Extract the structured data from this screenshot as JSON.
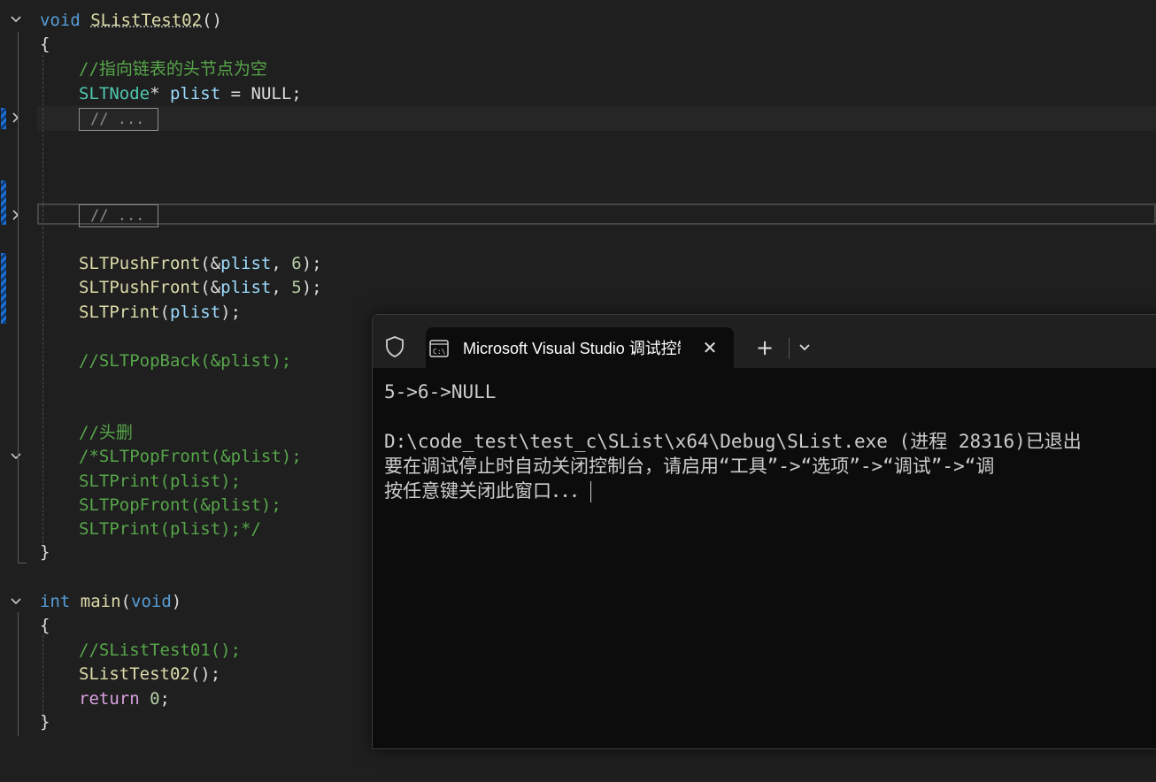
{
  "editor": {
    "lines": {
      "l_void": {
        "kw": "void",
        "fn": "SListTest02",
        "paren": "()"
      },
      "l_open1": "{",
      "l_cm1": "//指向链表的头节点为空",
      "l_decl": {
        "type": "SLTNode",
        "star": "*",
        "var": "plist",
        "rest": " = NULL;"
      },
      "l_collapsed1": "// ...",
      "l_collapsed2": "// ...",
      "l_push1": {
        "fn": "SLTPushFront",
        "pre": "(&",
        "var": "plist",
        "mid": ", ",
        "num": "6",
        "end": ");"
      },
      "l_push2": {
        "fn": "SLTPushFront",
        "pre": "(&",
        "var": "plist",
        "mid": ", ",
        "num": "5",
        "end": ");"
      },
      "l_print": {
        "fn": "SLTPrint",
        "pre": "(",
        "var": "plist",
        "end": ");"
      },
      "l_popback": "//SLTPopBack(&plist);",
      "l_cm_head": "//头删",
      "l_blk1": "/*SLTPopFront(&plist);",
      "l_blk2": "SLTPrint(plist);",
      "l_blk3": "SLTPopFront(&plist);",
      "l_blk4": "SLTPrint(plist);*/",
      "l_close1": "}",
      "l_main": {
        "kw": "int",
        "fn": "main",
        "pre": "(",
        "kw2": "void",
        "end": ")"
      },
      "l_open2": "{",
      "l_cm_test01": "//SListTest01();",
      "l_call02": {
        "fn": "SListTest02",
        "end": "();"
      },
      "l_return": {
        "kw": "return",
        "sp": " ",
        "num": "0",
        "end": ";"
      },
      "l_close2": "}"
    }
  },
  "terminal": {
    "tab_title": "Microsoft Visual Studio 调试控制台",
    "close_glyph": "✕",
    "new_tab_glyph": "+",
    "output": [
      "5->6->NULL",
      "",
      "D:\\code_test\\test_c\\SList\\x64\\Debug\\SList.exe (进程 28316)已退出",
      "要在调试停止时自动关闭控制台，请启用“工具”->“选项”->“调试”->“调",
      "按任意键关闭此窗口．．．"
    ]
  },
  "colors": {
    "editor_bg": "#1f1f1f",
    "keyword": "#569cd6",
    "function": "#dcdcaa",
    "type": "#4ec9b0",
    "variable": "#9cdcfe",
    "comment": "#57a64a",
    "terminal_bg": "#0c0c0c"
  },
  "icons": [
    "chevron-down-icon",
    "chevron-right-icon",
    "shield-icon",
    "console-app-icon",
    "close-icon",
    "plus-icon",
    "dropdown-chevron-icon"
  ]
}
